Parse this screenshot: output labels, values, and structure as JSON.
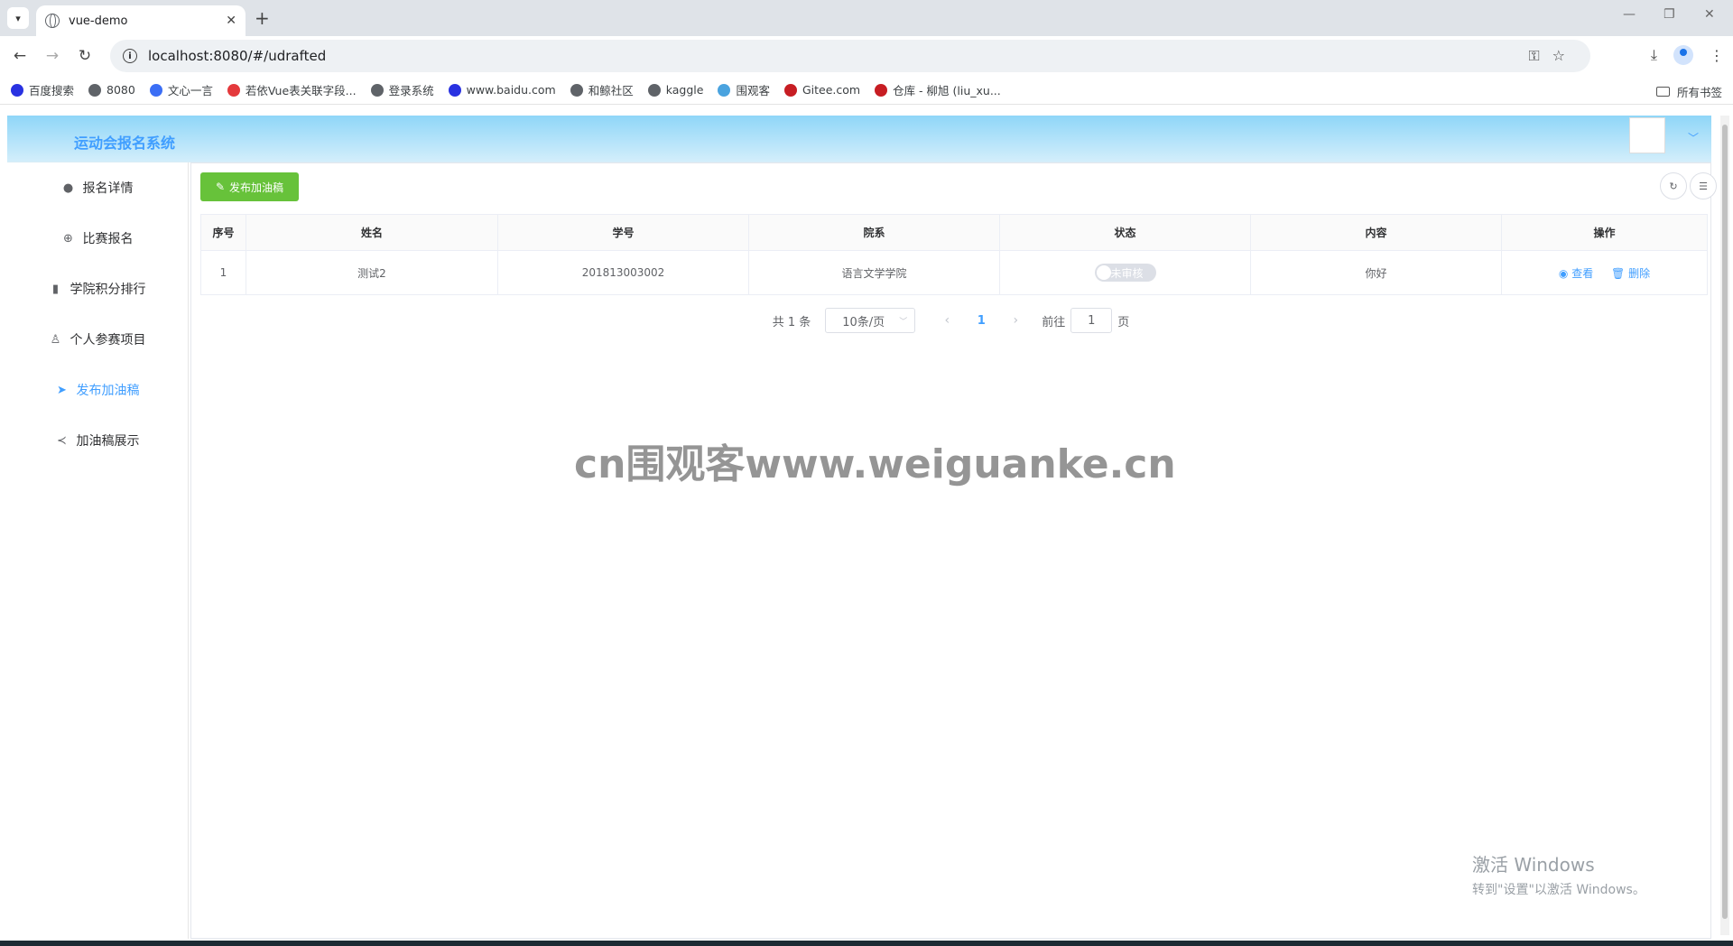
{
  "browser": {
    "tab_title": "vue-demo",
    "tab_close": "✕",
    "new_tab": "+",
    "url": "localhost:8080/#/udrafted",
    "bookmarks": [
      {
        "label": "百度搜索",
        "color": "#2932e1"
      },
      {
        "label": "8080",
        "color": "#5f6368"
      },
      {
        "label": "文心一言",
        "color": "#3b6ef5"
      },
      {
        "label": "若依Vue表关联字段...",
        "color": "#e4393c"
      },
      {
        "label": "登录系统",
        "color": "#5f6368"
      },
      {
        "label": "www.baidu.com",
        "color": "#2932e1"
      },
      {
        "label": "和鲸社区",
        "color": "#5f6368"
      },
      {
        "label": "kaggle",
        "color": "#5f6368"
      },
      {
        "label": "围观客",
        "color": "#4aa3df"
      },
      {
        "label": "Gitee.com",
        "color": "#c71d23"
      },
      {
        "label": "仓库 - 柳旭 (liu_xu...",
        "color": "#c71d23"
      }
    ],
    "all_bookmarks": "所有书签"
  },
  "app": {
    "title": "运动会报名系统",
    "accent": "#409eff"
  },
  "sidebar": {
    "items": [
      {
        "label": "报名详情",
        "icon": "bulb-icon",
        "glyph": "●"
      },
      {
        "label": "比赛报名",
        "icon": "plus-circle-icon",
        "glyph": "⊕"
      },
      {
        "label": "学院积分排行",
        "icon": "bar-chart-icon",
        "glyph": "▮"
      },
      {
        "label": "个人参赛项目",
        "icon": "user-icon",
        "glyph": "♙"
      },
      {
        "label": "发布加油稿",
        "icon": "send-icon",
        "glyph": "➤",
        "active": true
      },
      {
        "label": "加油稿展示",
        "icon": "share-icon",
        "glyph": "≺"
      }
    ]
  },
  "main": {
    "publish_button": "发布加油稿",
    "table": {
      "headers": [
        "序号",
        "姓名",
        "学号",
        "院系",
        "状态",
        "内容",
        "操作"
      ],
      "rows": [
        {
          "index": "1",
          "name": "测试2",
          "student_id": "201813003002",
          "department": "语言文学学院",
          "status": "未审核",
          "content": "你好",
          "view": "查看",
          "delete": "删除"
        }
      ]
    },
    "pagination": {
      "total": "共 1 条",
      "page_size": "10条/页",
      "current_page": "1",
      "goto_label": "前往",
      "goto_value": "1",
      "page_suffix": "页"
    }
  },
  "overlay": {
    "watermark": "cn围观客www.weiguanke.cn",
    "activate_title": "激活 Windows",
    "activate_sub": "转到\"设置\"以激活 Windows。"
  }
}
